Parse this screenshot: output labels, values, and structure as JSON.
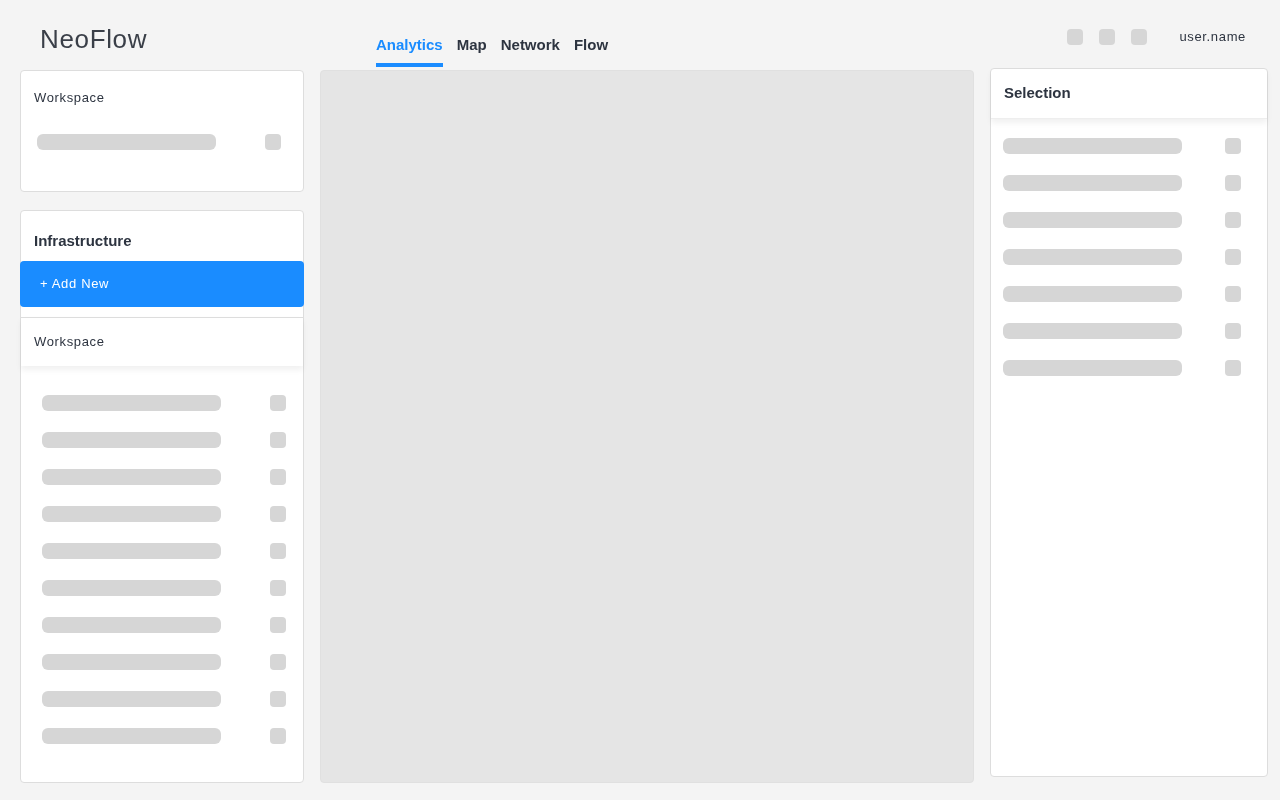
{
  "app": {
    "logo": "NeoFlow",
    "user": "user.name"
  },
  "tabs": [
    {
      "label": "Analytics",
      "selected": true
    },
    {
      "label": "Map",
      "selected": false
    },
    {
      "label": "Network",
      "selected": false
    },
    {
      "label": "Flow",
      "selected": false
    }
  ],
  "workspace_card": {
    "title": "Workspace"
  },
  "infrastructure": {
    "title": "Infrastructure",
    "add_button": "+ Add New",
    "section_title": "Workspace"
  },
  "selection_panel": {
    "title": "Selection"
  }
}
